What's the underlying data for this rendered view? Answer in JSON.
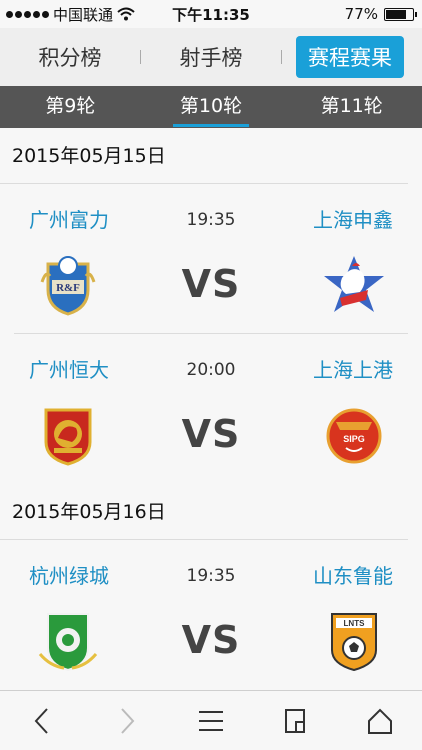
{
  "status": {
    "carrier": "中国联通",
    "time": "下午11:35",
    "battery_text": "77%",
    "battery_level": 0.77
  },
  "topnav": {
    "tabs": [
      {
        "label": "积分榜"
      },
      {
        "label": "射手榜"
      },
      {
        "label": "赛程赛果",
        "active": true
      }
    ]
  },
  "rounds": [
    {
      "label": "第9轮"
    },
    {
      "label": "第10轮",
      "active": true
    },
    {
      "label": "第11轮"
    }
  ],
  "sections": [
    {
      "date": "2015年05月15日",
      "matches": [
        {
          "home": "广州富力",
          "time": "19:35",
          "vs": "VS",
          "away": "上海申鑫",
          "home_logo": "rf-crest-icon",
          "away_logo": "shenxin-crest-icon"
        },
        {
          "home": "广州恒大",
          "time": "20:00",
          "vs": "VS",
          "away": "上海上港",
          "home_logo": "evergrande-crest-icon",
          "away_logo": "sipg-crest-icon"
        }
      ]
    },
    {
      "date": "2015年05月16日",
      "matches": [
        {
          "home": "杭州绿城",
          "time": "19:35",
          "vs": "VS",
          "away": "山东鲁能",
          "home_logo": "greentown-crest-icon",
          "away_logo": "luneng-crest-icon"
        }
      ]
    }
  ],
  "colors": {
    "accent": "#1aa0d8",
    "team_text": "#1f8fc4",
    "round_bar": "#555555"
  }
}
